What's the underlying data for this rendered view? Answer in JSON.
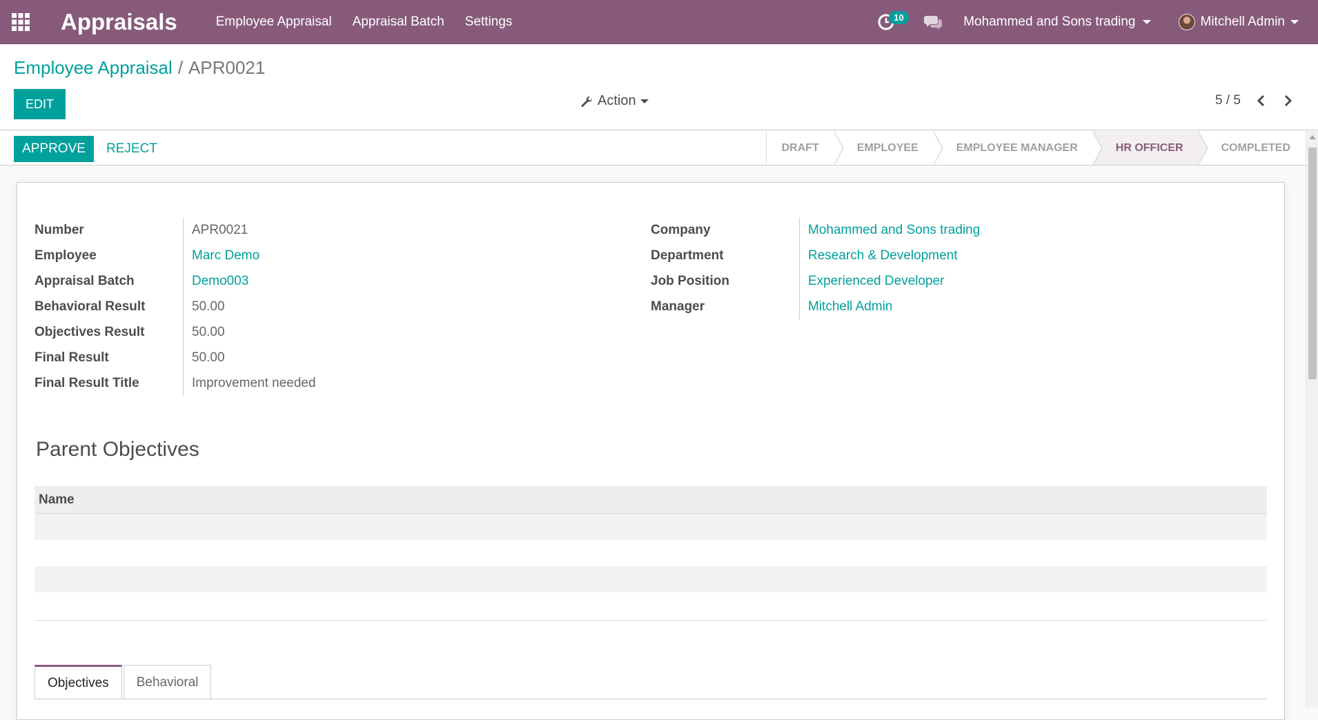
{
  "navbar": {
    "app_title": "Appraisals",
    "menu": [
      "Employee Appraisal",
      "Appraisal Batch",
      "Settings"
    ],
    "activity_count": "10",
    "company": "Mohammed and Sons trading",
    "user": "Mitchell Admin"
  },
  "breadcrumb": {
    "parent": "Employee Appraisal",
    "current": "APR0021"
  },
  "toolbar": {
    "edit_label": "EDIT",
    "action_label": "Action",
    "pager": "5 / 5"
  },
  "statusbar": {
    "approve_label": "APPROVE",
    "reject_label": "REJECT",
    "stages": [
      {
        "label": "DRAFT",
        "current": false
      },
      {
        "label": "EMPLOYEE",
        "current": false
      },
      {
        "label": "EMPLOYEE MANAGER",
        "current": false
      },
      {
        "label": "HR OFFICER",
        "current": true
      },
      {
        "label": "COMPLETED",
        "current": false
      }
    ]
  },
  "form": {
    "left": [
      {
        "label": "Number",
        "value": "APR0021",
        "link": false
      },
      {
        "label": "Employee",
        "value": "Marc Demo",
        "link": true
      },
      {
        "label": "Appraisal Batch",
        "value": "Demo003",
        "link": true
      },
      {
        "label": "Behavioral Result",
        "value": "50.00",
        "link": false
      },
      {
        "label": "Objectives Result",
        "value": "50.00",
        "link": false
      },
      {
        "label": "Final Result",
        "value": "50.00",
        "link": false
      },
      {
        "label": "Final Result Title",
        "value": "Improvement needed",
        "link": false
      }
    ],
    "right": [
      {
        "label": "Company",
        "value": "Mohammed and Sons trading",
        "link": true
      },
      {
        "label": "Department",
        "value": "Research & Development",
        "link": true
      },
      {
        "label": "Job Position",
        "value": "Experienced Developer",
        "link": true
      },
      {
        "label": "Manager",
        "value": "Mitchell Admin",
        "link": true
      }
    ]
  },
  "parent_objectives": {
    "title": "Parent Objectives",
    "columns": [
      "Name"
    ]
  },
  "tabs": [
    {
      "label": "Objectives",
      "active": true
    },
    {
      "label": "Behavioral",
      "active": false
    }
  ],
  "colors": {
    "brand": "#875a7b",
    "accent": "#00a09d"
  }
}
